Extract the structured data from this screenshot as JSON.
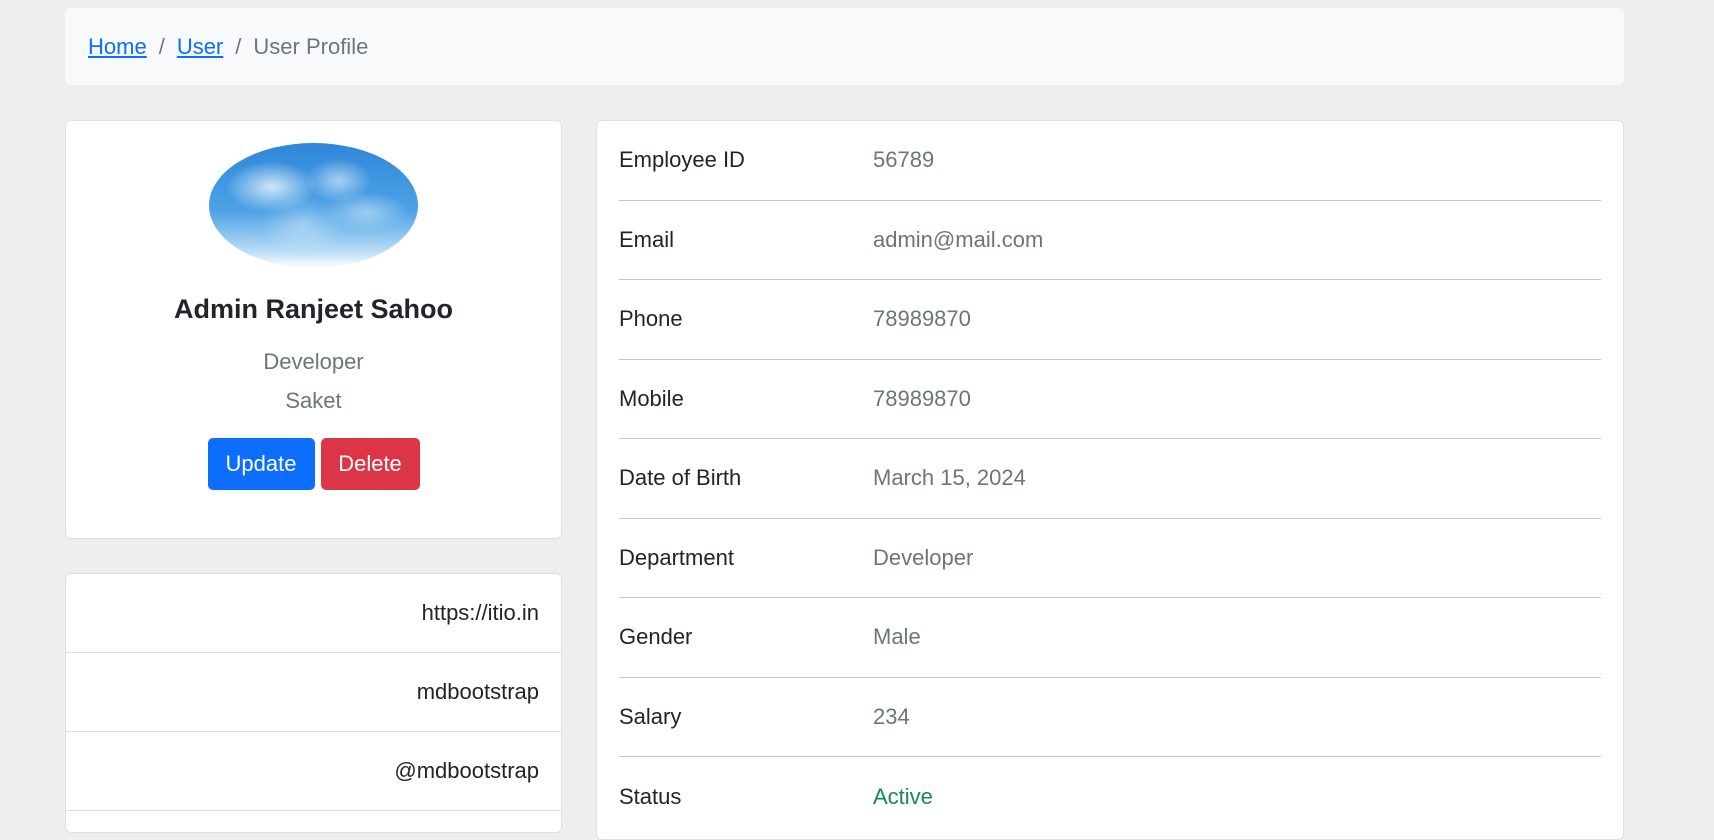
{
  "breadcrumb": {
    "home": "Home",
    "user": "User",
    "separator": "/",
    "current": "User Profile"
  },
  "profile": {
    "avatar_icon": "sky-photo-avatar",
    "name": "Admin Ranjeet Sahoo",
    "role": "Developer",
    "location": "Saket",
    "update_label": "Update",
    "delete_label": "Delete"
  },
  "links": [
    {
      "label": "https://itio.in"
    },
    {
      "label": "mdbootstrap"
    },
    {
      "label": "@mdbootstrap"
    }
  ],
  "details": [
    {
      "label": "Employee ID",
      "value": "56789"
    },
    {
      "label": "Email",
      "value": "admin@mail.com"
    },
    {
      "label": "Phone",
      "value": "78989870"
    },
    {
      "label": "Mobile",
      "value": "78989870"
    },
    {
      "label": "Date of Birth",
      "value": "March 15, 2024"
    },
    {
      "label": "Department",
      "value": "Developer"
    },
    {
      "label": "Gender",
      "value": "Male"
    },
    {
      "label": "Salary",
      "value": "234"
    },
    {
      "label": "Status",
      "value": "Active"
    }
  ],
  "colors": {
    "primary": "#0d6efd",
    "danger": "#dc3545",
    "success": "#198754",
    "muted": "#6c757d"
  }
}
